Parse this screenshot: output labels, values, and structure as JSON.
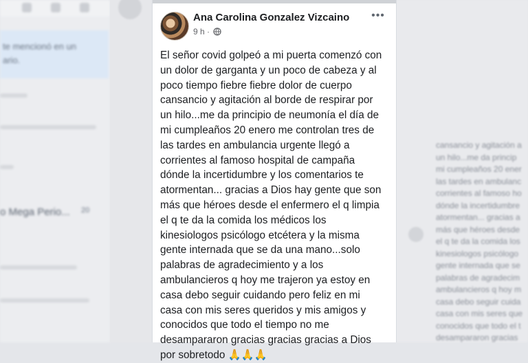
{
  "post": {
    "author": "Ana Carolina Gonzalez Vizcaino",
    "time": "9 h",
    "separator": "·",
    "privacy_icon": "globe-icon",
    "more_icon": "more-options-icon",
    "more_label": "•••",
    "text": "El señor covid golpeó a mi puerta comenzó con\nun dolor de garganta y un poco de cabeza y al\npoco tiempo fiebre fiebre dolor de cuerpo\ncansancio y agitación al borde de respirar por\nun hilo...me da principio de neumonía el día de\nmi cumpleaños 20 enero me controlan tres de\nlas tardes en ambulancia urgente llegó a\ncorrientes al famoso hospital de campaña\ndónde la incertidumbre y los comentarios te\natormentan... gracias a Dios hay gente que son\nmás que héroes desde el enfermero el q limpia\nel q te da la comida los médicos los\nkinesiologos psicólogo etcétera y la misma\ngente internada que se da una mano...solo\npalabras de agradecimiento y a los\nambulancieros q hoy me trajeron ya estoy en\ncasa debo seguir cuidando pero feliz en mi\ncasa con mis seres queridos y mis amigos y\nconocidos que todo el tiempo no me\ndesampararon gracias gracias gracias a Dios\npor sobretodo ",
    "emoji": "🙏🙏🙏"
  },
  "background_left": {
    "line1": "te mencionó en un",
    "line2": "ario.",
    "item": "o Mega Perio...",
    "badge": "20"
  },
  "background_right": {
    "lines": [
      "cansancio y agitación a",
      "un hilo...me da princip",
      "mi cumpleaños 20 ener",
      "las tardes en ambulanc",
      "corrientes al famoso ho",
      "dónde la incertidumbre",
      "atormentan... gracias a",
      "más que héroes desde",
      "el q te da la comida los",
      "kinesiologos psicólogo",
      "gente internada que se",
      "palabras de agradecim",
      "ambulancieros q hoy m",
      "casa debo seguir cuida",
      "casa con mis seres que",
      "conocidos que todo el t",
      "desampararon gracias"
    ]
  },
  "colors": {
    "text": "#1c1e21",
    "secondary": "#65676b",
    "card": "#ffffff",
    "page": "#e4e6ea"
  }
}
